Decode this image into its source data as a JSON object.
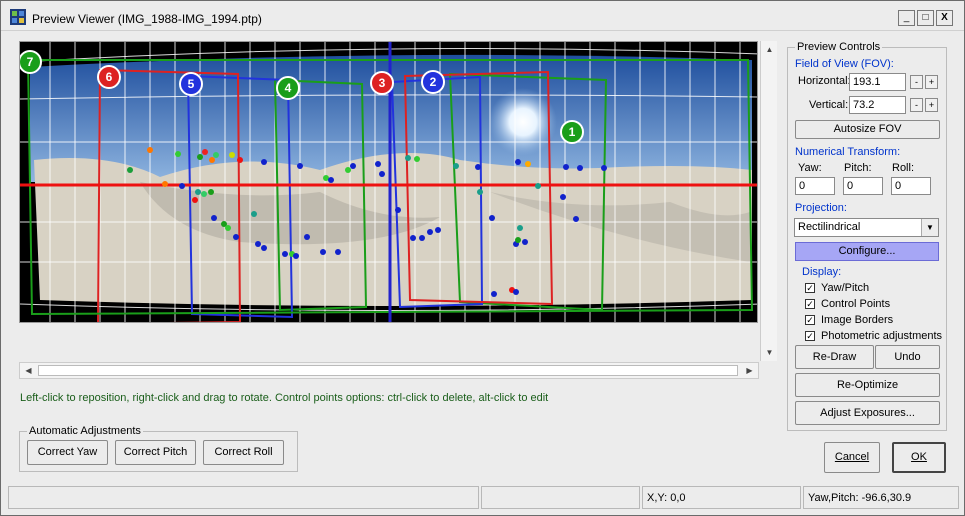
{
  "window": {
    "title": "Preview Viewer (IMG_1988-IMG_1994.ptp)",
    "minimize": "_",
    "maximize": "□",
    "close": "X"
  },
  "hint": "Left-click to reposition, right-click and drag to rotate. Control points options: ctrl-click to delete, alt-click to edit",
  "auto": {
    "group_label": "Automatic Adjustments",
    "yaw": "Correct Yaw",
    "pitch": "Correct Pitch",
    "roll": "Correct Roll"
  },
  "controls": {
    "group_label": "Preview Controls",
    "fov_label": "Field of View (FOV):",
    "horizontal_label": "Horizontal:",
    "horizontal_value": "193.1",
    "vertical_label": "Vertical:",
    "vertical_value": "73.2",
    "minus": "-",
    "plus": "+",
    "autosize": "Autosize FOV",
    "numerical_label": "Numerical Transform:",
    "yaw_label": "Yaw:",
    "pitch_label": "Pitch:",
    "roll_label": "Roll:",
    "yaw_value": "0",
    "pitch_value": "0",
    "roll_value": "0",
    "projection_label": "Projection:",
    "projection_value": "Rectilindrical",
    "configure": "Configure...",
    "display_label": "Display:",
    "display_items": [
      "Yaw/Pitch",
      "Control Points",
      "Image Borders",
      "Photometric adjustments"
    ],
    "redraw": "Re-Draw",
    "undo": "Undo",
    "reoptimize": "Re-Optimize",
    "adjust": "Adjust Exposures..."
  },
  "dialog": {
    "cancel": "Cancel",
    "ok": "OK"
  },
  "status": {
    "xy": "X,Y: 0,0",
    "yawpitch": "Yaw,Pitch: -96.6,30.9"
  },
  "images": [
    {
      "label": "1",
      "color": "#1a9e1a"
    },
    {
      "label": "2",
      "color": "#2233dd"
    },
    {
      "label": "3",
      "color": "#dd2222"
    },
    {
      "label": "4",
      "color": "#1a9e1a"
    },
    {
      "label": "5",
      "color": "#2233dd"
    },
    {
      "label": "6",
      "color": "#dd2222"
    },
    {
      "label": "7",
      "color": "#1a9e1a"
    }
  ],
  "colors": {
    "horizon": "#ee1111",
    "vertical_axis": "#2222cc",
    "sky": "#3c6fb8",
    "sand": "#d8d2c4"
  }
}
